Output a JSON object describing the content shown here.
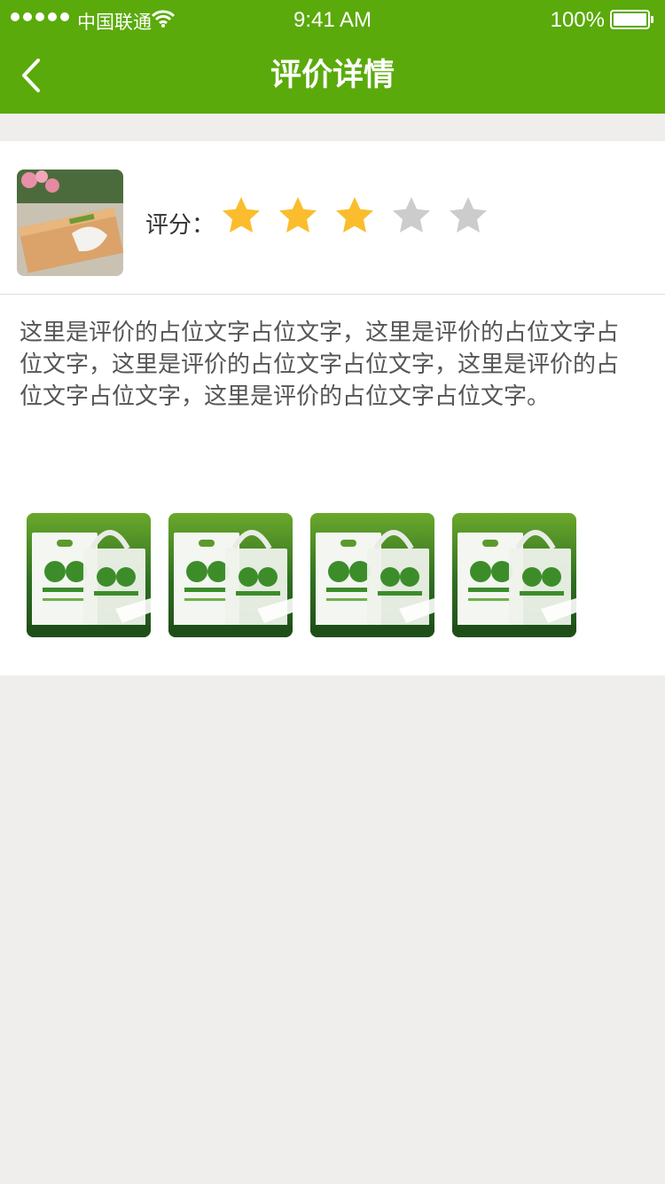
{
  "status_bar": {
    "carrier": "中国联通",
    "time": "9:41 AM",
    "battery": "100%"
  },
  "header": {
    "title": "评价详情",
    "back_icon": "chevron-left-icon"
  },
  "review": {
    "rating_label": "评分：",
    "rating": 3,
    "rating_max": 5,
    "star_filled_color": "#fbbd2d",
    "star_empty_color": "#cccccc",
    "text": "这里是评价的占位文字占位文字，这里是评价的占位文字占位文字，这里是评价的占位文字占位文字，这里是评价的占位文字占位文字，这里是评价的占位文字占位文字。",
    "photo_count": 4
  },
  "colors": {
    "header_bg": "#5aaa0b",
    "page_bg": "#efeeec"
  }
}
